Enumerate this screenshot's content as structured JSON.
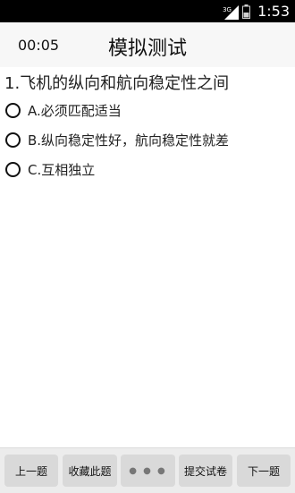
{
  "status_bar": {
    "network": "3G",
    "time": "1:53"
  },
  "header": {
    "timer": "00:05",
    "title": "模拟测试"
  },
  "question": {
    "text": "1.飞机的纵向和航向稳定性之间",
    "options": [
      "A.必须匹配适当",
      "B.纵向稳定性好，航向稳定性就差",
      "C.互相独立"
    ]
  },
  "toolbar": {
    "prev_label": "上一题",
    "favorite_label": "收藏此题",
    "more_label": "● ● ●",
    "submit_label": "提交试卷",
    "next_label": "下一题"
  },
  "icons": [
    "signal-icon",
    "battery-icon",
    "radio-icon",
    "more-icon"
  ]
}
